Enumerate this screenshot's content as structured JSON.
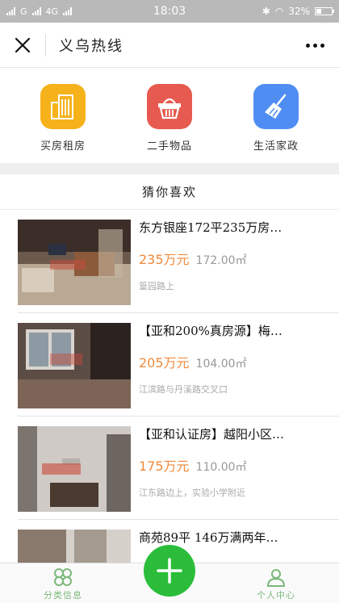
{
  "status": {
    "carrier1": "G",
    "carrier2": "4G",
    "time": "18:03",
    "battery": "32%",
    "battery_level": 0.32
  },
  "nav": {
    "title": "义乌热线"
  },
  "categories": [
    {
      "label": "买房租房",
      "icon": "building-icon",
      "color": "#f6b21b"
    },
    {
      "label": "二手物品",
      "icon": "basket-icon",
      "color": "#e65a4f"
    },
    {
      "label": "生活家政",
      "icon": "broom-icon",
      "color": "#4f8df2"
    }
  ],
  "section_title": "猜你喜欢",
  "listings": [
    {
      "title": "东方银座172平235万房…",
      "price": "235万元",
      "area": "172.00㎡",
      "location": "篁园路上"
    },
    {
      "title": "【亚和200%真房源】梅…",
      "price": "205万元",
      "area": "104.00㎡",
      "location": "江滨路与丹溪路交叉口"
    },
    {
      "title": "【亚和认证房】越阳小区…",
      "price": "175万元",
      "area": "110.00㎡",
      "location": "江东路边上，实验小学附近"
    },
    {
      "title": "商苑89平 146万满两年…",
      "price": "",
      "area": "",
      "location": ""
    }
  ],
  "tabbar": {
    "left_label": "分类信息",
    "right_label": "个人中心"
  },
  "colors": {
    "accent_green": "#2bbd3a",
    "price_orange": "#f08a3b"
  }
}
